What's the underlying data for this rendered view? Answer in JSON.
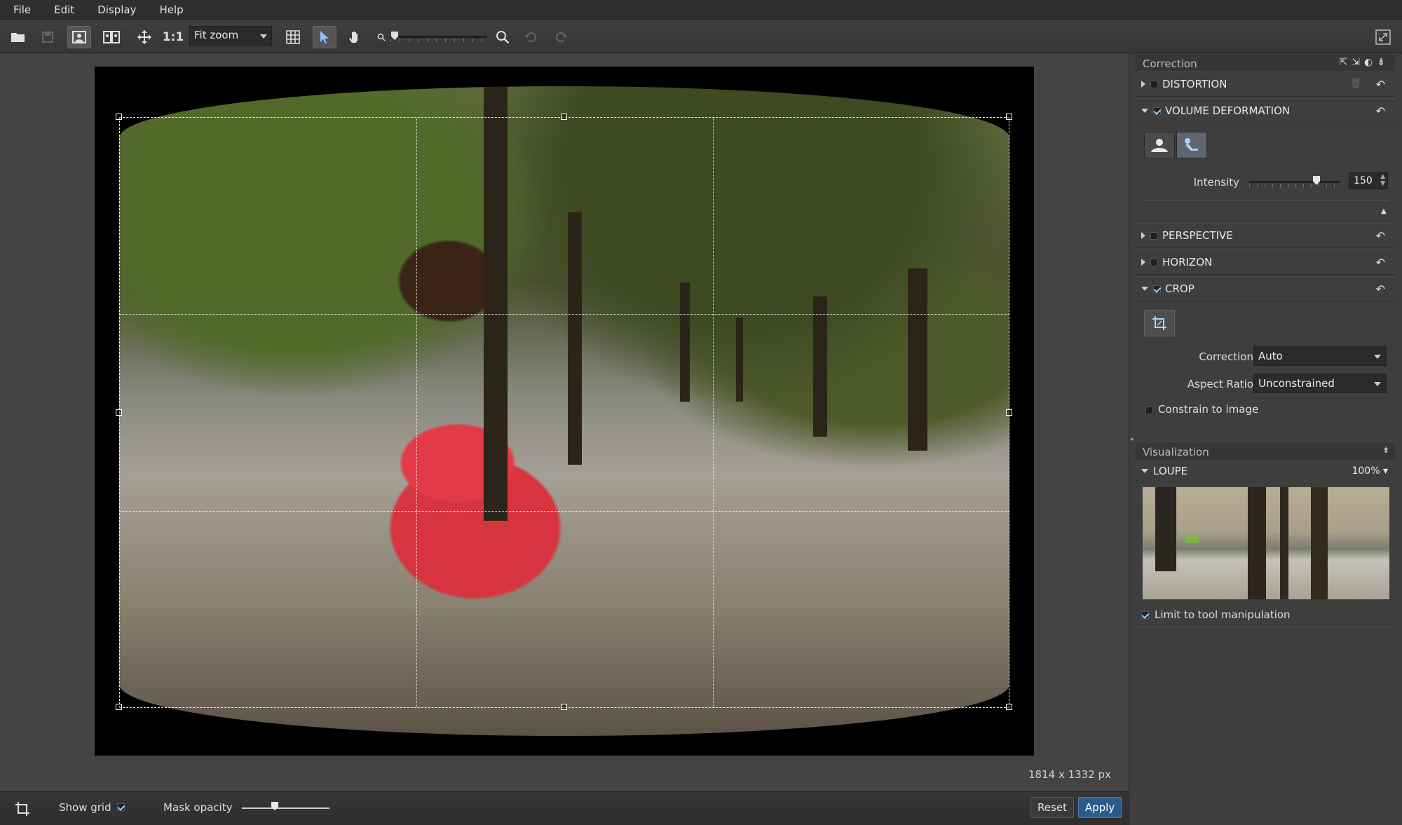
{
  "menu": [
    "File",
    "Edit",
    "Display",
    "Help"
  ],
  "toolbar": {
    "one_to_one": "1:1",
    "zoom_select": "Fit zoom",
    "icons": [
      "open-icon",
      "save-icon",
      "single-view-icon",
      "compare-view-icon",
      "move-icon",
      "grid-icon",
      "select-icon",
      "hand-icon",
      "zoom-out-icon",
      "zoom-in-icon",
      "undo-icon",
      "redo-icon",
      "fullscreen-icon"
    ]
  },
  "canvas": {
    "dimensions": "1814 x 1332 px"
  },
  "bottom": {
    "show_grid_label": "Show grid",
    "show_grid_checked": true,
    "mask_opacity_label": "Mask opacity",
    "mask_opacity_value": 0.33,
    "reset_label": "Reset",
    "apply_label": "Apply"
  },
  "correction_panel": {
    "title": "Correction",
    "sections": {
      "distortion": {
        "label": "DISTORTION",
        "checked": false
      },
      "volume": {
        "label": "VOLUME DEFORMATION",
        "checked": true,
        "intensity_label": "Intensity",
        "intensity_value": "150"
      },
      "perspective": {
        "label": "PERSPECTIVE",
        "checked": false
      },
      "horizon": {
        "label": "HORIZON",
        "checked": false
      },
      "crop": {
        "label": "CROP",
        "checked": true,
        "correction_label": "Correction",
        "correction_value": "Auto",
        "aspect_label": "Aspect Ratio",
        "aspect_value": "Unconstrained",
        "constrain_label": "Constrain to image",
        "constrain_checked": false
      }
    }
  },
  "visualization_panel": {
    "title": "Visualization",
    "loupe_label": "LOUPE",
    "loupe_zoom": "100%",
    "limit_label": "Limit to tool manipulation",
    "limit_checked": true
  }
}
